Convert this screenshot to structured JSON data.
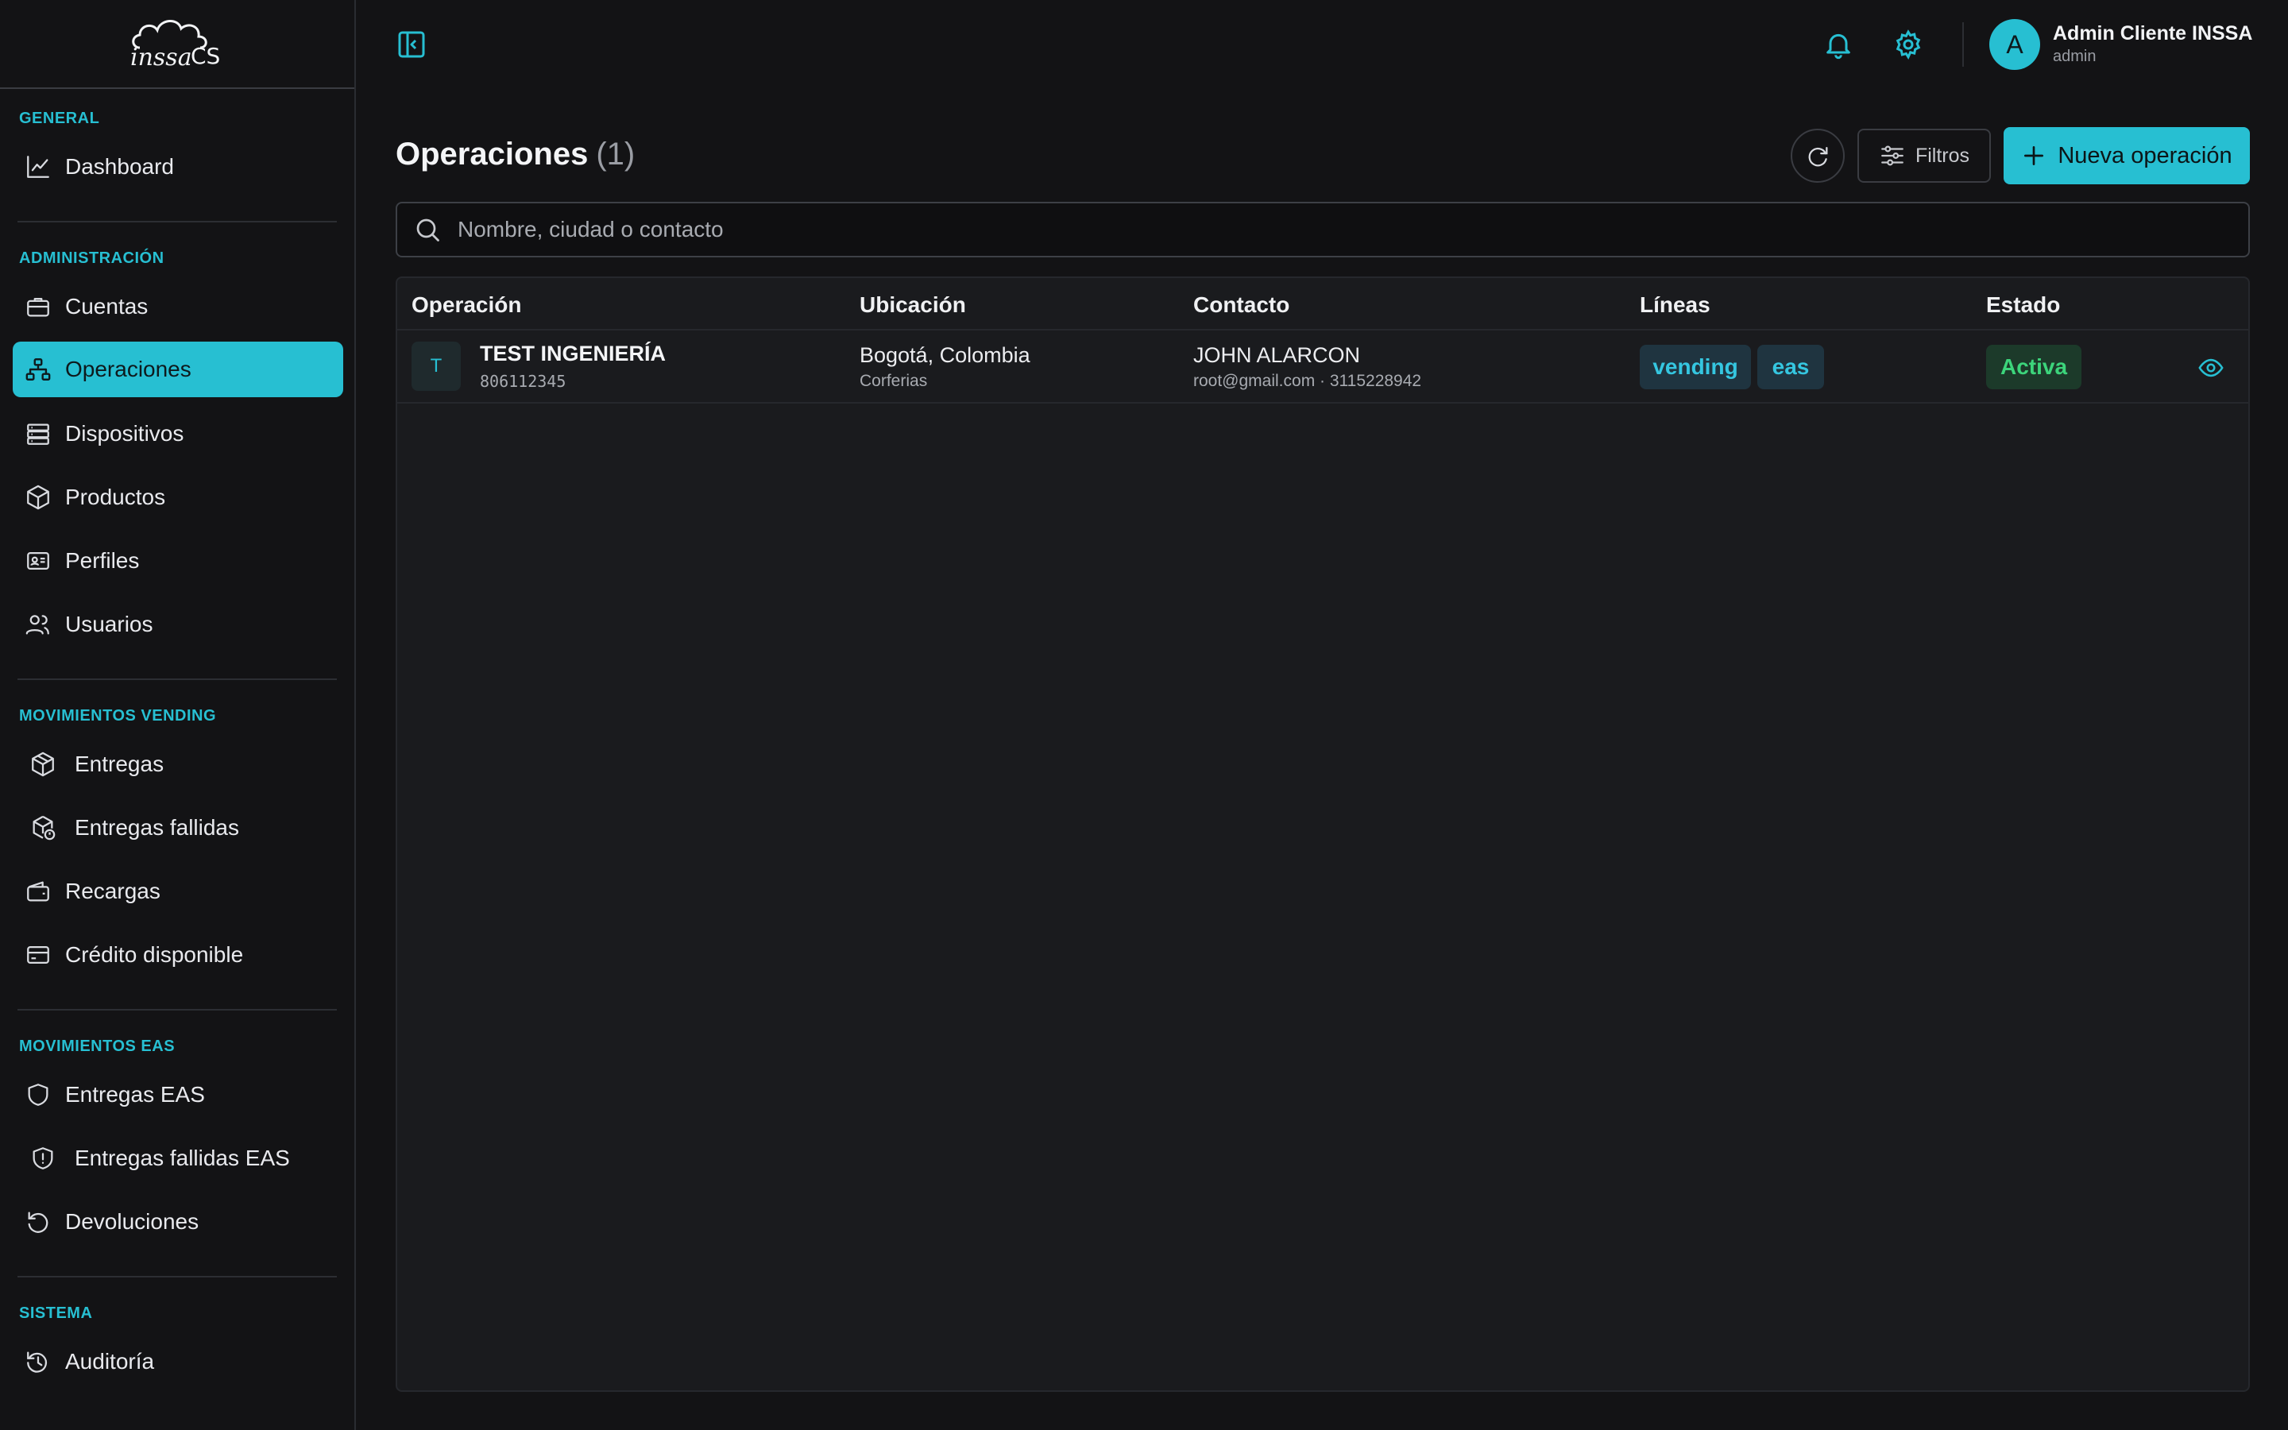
{
  "brand": {
    "logo_text": "inssa CS"
  },
  "sidebar": {
    "sections": [
      {
        "label": "GENERAL"
      },
      {
        "label": "ADMINISTRACIÓN"
      },
      {
        "label": "MOVIMIENTOS VENDING"
      },
      {
        "label": "MOVIMIENTOS EAS"
      },
      {
        "label": "SISTEMA"
      }
    ],
    "items": [
      {
        "label": "Dashboard",
        "icon": "chart-line-icon"
      },
      {
        "label": "Cuentas",
        "icon": "briefcase-icon"
      },
      {
        "label": "Operaciones",
        "icon": "network-icon",
        "active": true
      },
      {
        "label": "Dispositivos",
        "icon": "server-icon"
      },
      {
        "label": "Productos",
        "icon": "box-icon"
      },
      {
        "label": "Perfiles",
        "icon": "id-card-icon"
      },
      {
        "label": "Usuarios",
        "icon": "users-icon"
      },
      {
        "label": "Entregas",
        "icon": "package-icon"
      },
      {
        "label": "Entregas fallidas",
        "icon": "package-alert-icon"
      },
      {
        "label": "Recargas",
        "icon": "wallet-icon"
      },
      {
        "label": "Crédito disponible",
        "icon": "credit-card-icon"
      },
      {
        "label": "Entregas EAS",
        "icon": "shield-icon"
      },
      {
        "label": "Entregas fallidas EAS",
        "icon": "shield-alert-icon"
      },
      {
        "label": "Devoluciones",
        "icon": "rotate-ccw-icon"
      },
      {
        "label": "Auditoría",
        "icon": "history-icon"
      }
    ]
  },
  "header": {
    "user": {
      "name": "Admin Cliente INSSA",
      "role": "admin",
      "initial": "A"
    }
  },
  "main": {
    "title": "Operaciones",
    "count": "(1)",
    "filters_label": "Filtros",
    "new_button_label": "Nueva operación",
    "search_placeholder": "Nombre, ciudad o contacto",
    "table": {
      "columns": [
        "Operación",
        "Ubicación",
        "Contacto",
        "Líneas",
        "Estado"
      ],
      "rows": [
        {
          "initial": "T",
          "name": "TEST INGENIERÍA",
          "code": "806112345",
          "location": "Bogotá, Colombia",
          "venue": "Corferias",
          "contact_name": "JOHN ALARCON",
          "contact_detail": "root@gmail.com · 3115228942",
          "lines": [
            "vending",
            "eas"
          ],
          "status": "Activa"
        }
      ]
    }
  },
  "colors": {
    "accent": "#27bfd2",
    "background": "#131315",
    "status_active": "#3cd47b"
  }
}
